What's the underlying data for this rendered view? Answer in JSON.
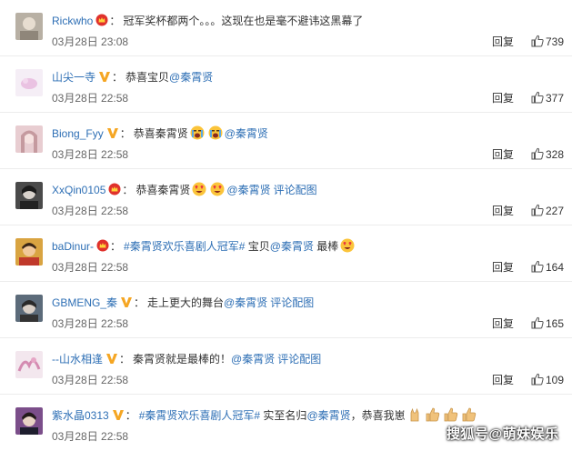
{
  "reply_label": "回复",
  "comments": [
    {
      "user": "Rickwho",
      "time": "03月28日 23:08",
      "likes": "739",
      "text": "冠军奖杯都两个。。。这现在也是毫不避讳这黑幕了"
    },
    {
      "user": "山尖一寺",
      "time": "03月28日 22:58",
      "likes": "377",
      "text": "恭喜宝贝",
      "mention": "@秦霄贤"
    },
    {
      "user": "Biong_Fyy",
      "time": "03月28日 22:58",
      "likes": "328",
      "text": "恭喜秦霄贤",
      "mention": "@秦霄贤"
    },
    {
      "user": "XxQin0105",
      "time": "03月28日 22:58",
      "likes": "227",
      "text": "恭喜秦霄贤",
      "mention": "@秦霄贤",
      "pic": "评论配图"
    },
    {
      "user": "baDinur-",
      "time": "03月28日 22:58",
      "likes": "164",
      "topic": "#秦霄贤欢乐喜剧人冠军#",
      "text": "宝贝",
      "mention": "@秦霄贤",
      "text2": "最棒"
    },
    {
      "user": "GBMENG_秦",
      "time": "03月28日 22:58",
      "likes": "165",
      "text": "走上更大的舞台",
      "mention": "@秦霄贤",
      "pic": "评论配图"
    },
    {
      "user": "--山水相逢",
      "time": "03月28日 22:58",
      "likes": "109",
      "text": "秦霄贤就是最棒的！",
      "mention": "@秦霄贤",
      "pic": "评论配图"
    },
    {
      "user": "紫水晶0313",
      "time": "03月28日 22:58",
      "likes": "",
      "topic": "#秦霄贤欢乐喜剧人冠军#",
      "text": "实至名归",
      "mention": "@秦霄贤",
      "text2": "，恭喜我崽"
    }
  ],
  "watermark": "搜狐号@萌妹娱乐"
}
